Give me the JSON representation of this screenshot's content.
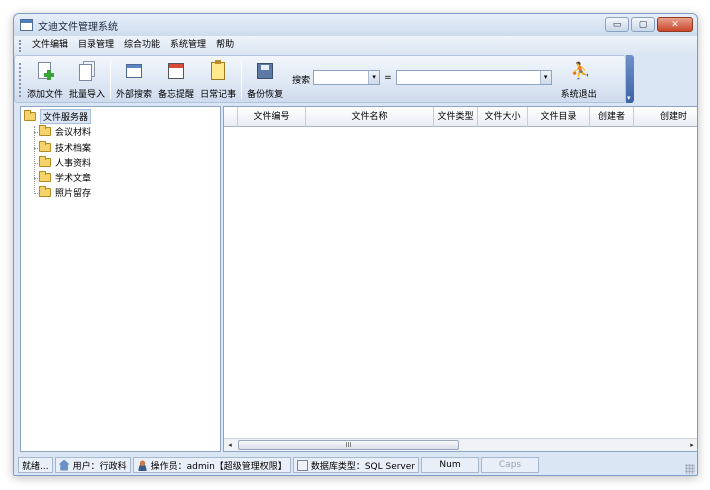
{
  "window": {
    "title": "文迪文件管理系统",
    "controls": {
      "minimize": "▭",
      "maximize": "▢",
      "close": "✕"
    }
  },
  "menu": [
    "文件编辑",
    "目录管理",
    "综合功能",
    "系统管理",
    "帮助"
  ],
  "toolbar": {
    "buttons": [
      {
        "label": "添加文件",
        "icon": "add-file-icon"
      },
      {
        "label": "批量导入",
        "icon": "batch-import-icon"
      },
      {
        "label": "外部搜索",
        "icon": "external-search-icon"
      },
      {
        "label": "备忘提醒",
        "icon": "calendar-icon"
      },
      {
        "label": "日常记事",
        "icon": "notepad-icon"
      },
      {
        "label": "备份恢复",
        "icon": "floppy-disk-icon"
      }
    ],
    "search_label": "搜索",
    "search_field_value": "",
    "equals_sign": "=",
    "search_value": "",
    "exit_label": "系统退出"
  },
  "tree": {
    "root": "文件服务器",
    "children": [
      "会议材料",
      "技术档案",
      "人事资料",
      "学术文章",
      "照片留存"
    ]
  },
  "grid": {
    "columns": [
      "文件编号",
      "文件名称",
      "文件类型",
      "文件大小",
      "文件目录",
      "创建者",
      "创建时"
    ],
    "rows": [],
    "scroll_thumb_label": "III"
  },
  "status": {
    "ready": "就绪...",
    "user": "用户：行政科",
    "operator": "操作员：admin【超级管理权限】",
    "db_type": "数据库类型：SQL Server",
    "num": "Num",
    "caps": "Caps"
  }
}
